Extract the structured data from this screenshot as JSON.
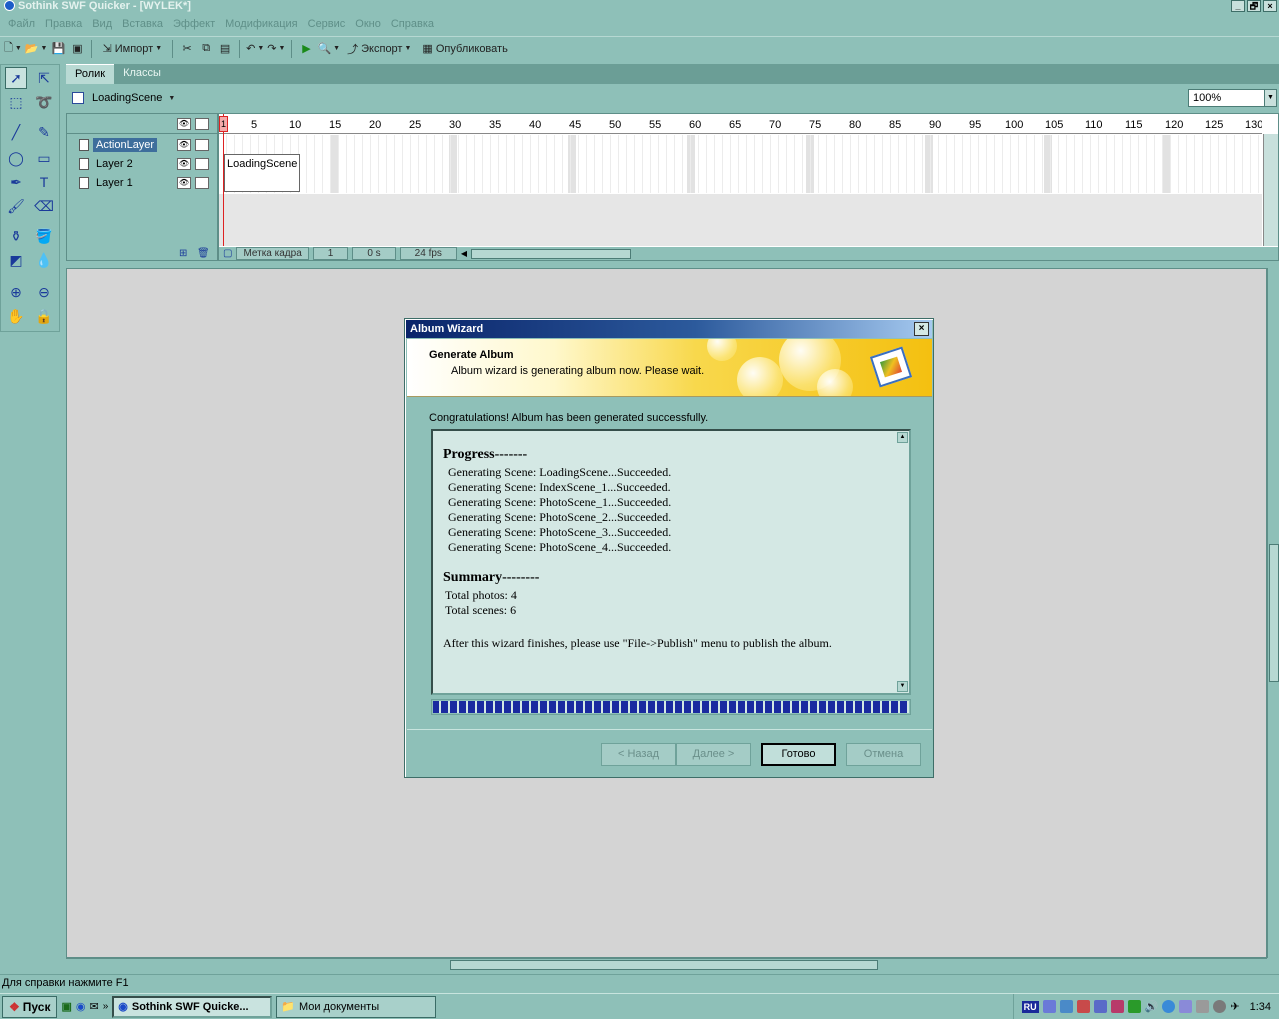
{
  "window": {
    "title": "Sothink SWF Quicker - [WYLEK*]",
    "controls": [
      "_",
      "🗗",
      "×"
    ]
  },
  "menu": [
    "Файл",
    "Правка",
    "Вид",
    "Вставка",
    "Эффект",
    "Модификация",
    "Сервис",
    "Окно",
    "Справка"
  ],
  "toolbar": {
    "import_label": "Импорт",
    "export_label": "Экспорт",
    "publish_label": "Опубликовать"
  },
  "tabs": [
    "Ролик",
    "Классы"
  ],
  "scene": {
    "name": "LoadingScene"
  },
  "zoom": {
    "value": "100%"
  },
  "layers": [
    {
      "name": "ActionLayer",
      "active": true
    },
    {
      "name": "Layer 2",
      "active": false
    },
    {
      "name": "Layer 1",
      "active": false
    }
  ],
  "ruler": {
    "first_marker": "1",
    "ticks": [
      "5",
      "10",
      "15",
      "20",
      "25",
      "30",
      "35",
      "40",
      "45",
      "50",
      "55",
      "60",
      "65",
      "70",
      "75",
      "80",
      "85",
      "90",
      "95",
      "100",
      "105",
      "110",
      "115",
      "120",
      "125",
      "130"
    ]
  },
  "timeline": {
    "frame_label": "LoadingScene",
    "status_label": "Метка кадра",
    "frame": "1",
    "time": "0 s",
    "fps": "24 fps"
  },
  "dialog": {
    "title": "Album Wizard",
    "close": "×",
    "banner_title": "Generate Album",
    "banner_subtitle": "Album wizard is generating album now. Please wait.",
    "congrats": "Congratulations! Album has been generated successfully.",
    "progress_heading": "Progress-------",
    "progress_lines": [
      "Generating Scene: LoadingScene...Succeeded.",
      "Generating Scene: IndexScene_1...Succeeded.",
      "Generating Scene: PhotoScene_1...Succeeded.",
      "Generating Scene: PhotoScene_2...Succeeded.",
      "Generating Scene: PhotoScene_3...Succeeded.",
      "Generating Scene: PhotoScene_4...Succeeded."
    ],
    "summary_heading": "Summary--------",
    "summary_lines": [
      "Total photos: 4",
      "Total scenes: 6"
    ],
    "after_text": "After this wizard finishes, please use \"File->Publish\" menu to publish the album.",
    "progress_fraction": 1.0,
    "buttons": {
      "back": "< Назад",
      "next": "Далее >",
      "finish": "Готово",
      "cancel": "Отмена"
    }
  },
  "statusbar": {
    "text": "Для справки нажмите F1"
  },
  "taskbar": {
    "start": "Пуск",
    "items": [
      {
        "label": "Sothink SWF Quicke...",
        "active": true
      },
      {
        "label": "Мои документы",
        "active": false
      }
    ],
    "clock": "1:34",
    "lang": "RU"
  }
}
